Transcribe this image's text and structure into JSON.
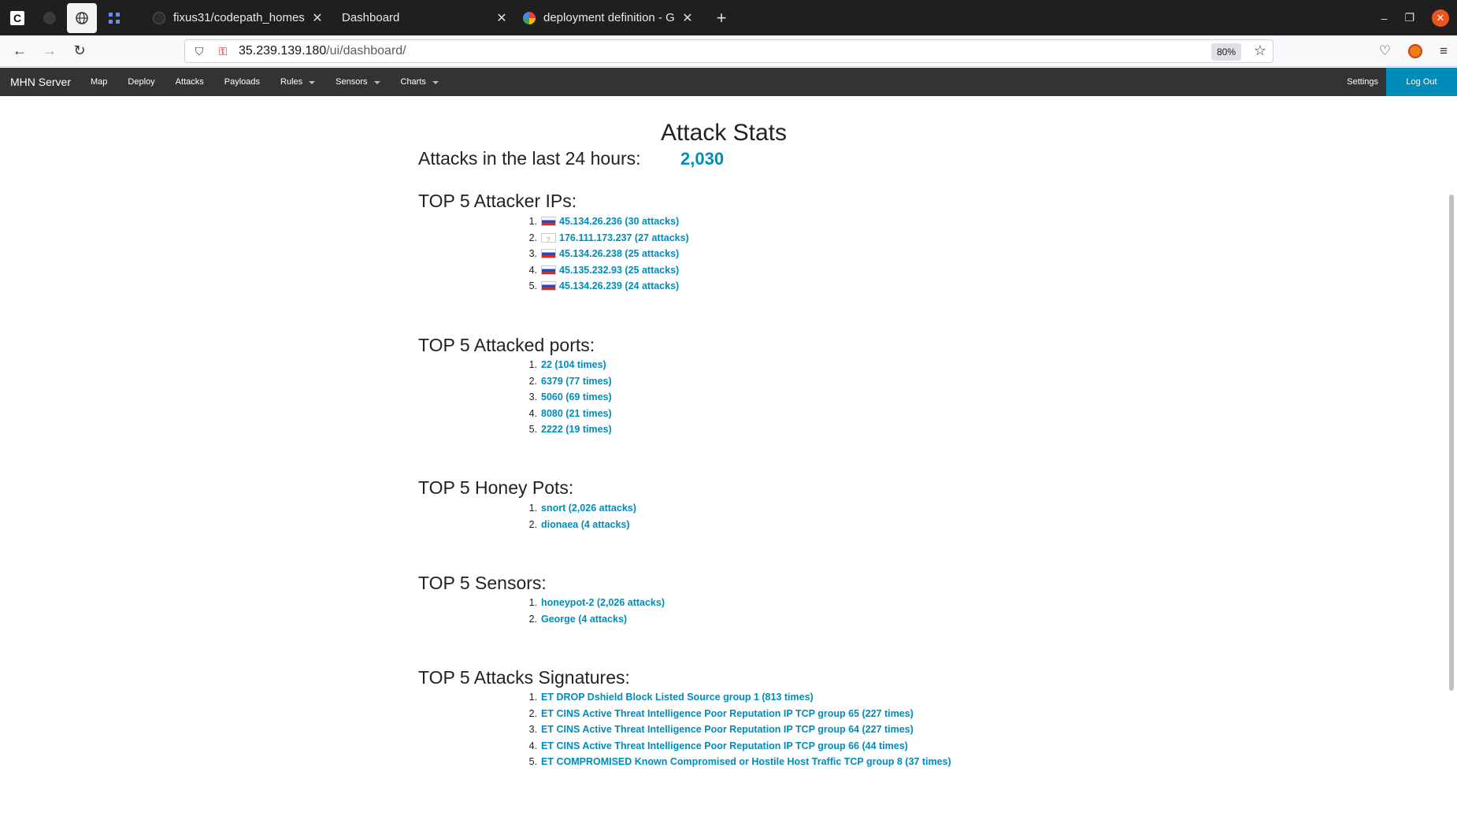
{
  "browser": {
    "tabs": [
      {
        "title": "fixus31/codepath_homes",
        "close": "✕"
      },
      {
        "title": "Dashboard",
        "close": "✕"
      },
      {
        "title": "deployment definition - G",
        "close": "✕"
      }
    ],
    "new_tab": "+",
    "url_host": "35.239.139.180",
    "url_path": "/ui/dashboard/",
    "zoom": "80%"
  },
  "appnav": {
    "brand": "MHN Server",
    "items": [
      "Map",
      "Deploy",
      "Attacks",
      "Payloads",
      "Rules",
      "Sensors",
      "Charts"
    ],
    "settings": "Settings",
    "logout": "Log Out"
  },
  "page": {
    "title": "Attack Stats",
    "attacks_label": "Attacks in the last 24 hours:",
    "attacks_total": "2,030",
    "sections": {
      "ips": {
        "heading": "TOP 5 Attacker IPs:",
        "items": [
          {
            "n": "1.",
            "text": "45.134.26.236 (30 attacks)",
            "flag": "russia-flag"
          },
          {
            "n": "2.",
            "text": "176.111.173.237 (27 attacks)",
            "flag": "unknown-flag"
          },
          {
            "n": "3.",
            "text": "45.134.26.238 (25 attacks)",
            "flag": "russia-flag"
          },
          {
            "n": "4.",
            "text": "45.135.232.93 (25 attacks)",
            "flag": "russia-flag"
          },
          {
            "n": "5.",
            "text": "45.134.26.239 (24 attacks)",
            "flag": "russia-flag"
          }
        ]
      },
      "ports": {
        "heading": "TOP 5 Attacked ports:",
        "items": [
          {
            "n": "1.",
            "text": "22 (104 times)"
          },
          {
            "n": "2.",
            "text": "6379 (77 times)"
          },
          {
            "n": "3.",
            "text": "5060 (69 times)"
          },
          {
            "n": "4.",
            "text": "8080 (21 times)"
          },
          {
            "n": "5.",
            "text": "2222 (19 times)"
          }
        ]
      },
      "honeypots": {
        "heading": "TOP 5 Honey Pots:",
        "items": [
          {
            "n": "1.",
            "text": "snort (2,026 attacks)"
          },
          {
            "n": "2.",
            "text": "dionaea (4 attacks)"
          }
        ]
      },
      "sensors": {
        "heading": "TOP 5 Sensors:",
        "items": [
          {
            "n": "1.",
            "text": "honeypot-2 (2,026 attacks)"
          },
          {
            "n": "2.",
            "text": "George (4 attacks)"
          }
        ]
      },
      "signatures": {
        "heading": "TOP 5 Attacks Signatures:",
        "items": [
          {
            "n": "1.",
            "text": "ET DROP Dshield Block Listed Source group 1 (813 times)"
          },
          {
            "n": "2.",
            "text": "ET CINS Active Threat Intelligence Poor Reputation IP TCP group 65 (227 times)"
          },
          {
            "n": "3.",
            "text": "ET CINS Active Threat Intelligence Poor Reputation IP TCP group 64 (227 times)"
          },
          {
            "n": "4.",
            "text": "ET CINS Active Threat Intelligence Poor Reputation IP TCP group 66 (44 times)"
          },
          {
            "n": "5.",
            "text": "ET COMPROMISED Known Compromised or Hostile Host Traffic TCP group 8 (37 times)"
          }
        ]
      }
    }
  },
  "colors": {
    "accent": "#008cba",
    "navbar": "#333333",
    "tabstrip": "#1f1f1f"
  }
}
